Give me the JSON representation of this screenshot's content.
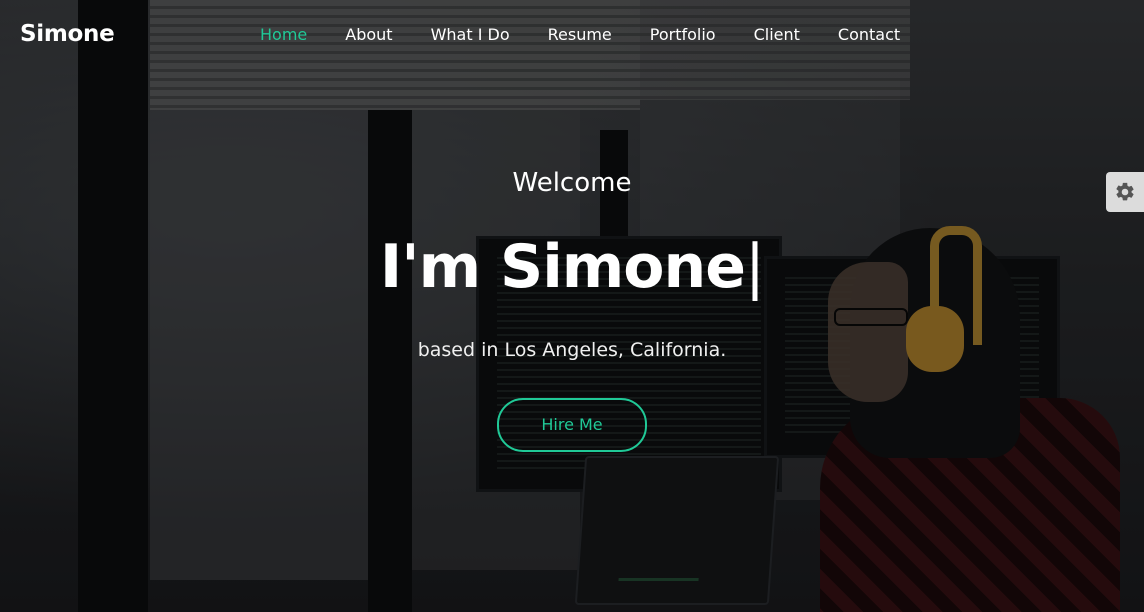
{
  "brand": {
    "name": "Simone"
  },
  "nav": {
    "items": [
      "Home",
      "About",
      "What I Do",
      "Resume",
      "Portfolio",
      "Client",
      "Contact"
    ],
    "active": "Home"
  },
  "hero": {
    "welcome": "Welcome",
    "headline": "I'm Simone",
    "cursor": "|",
    "subtitle": "based in Los Angeles, California.",
    "cta_label": "Hire Me"
  },
  "settings": {
    "icon": "gear-icon"
  },
  "colors": {
    "accent": "#20c997",
    "text": "#ffffff",
    "settings_tab": "#dcdcdc"
  }
}
